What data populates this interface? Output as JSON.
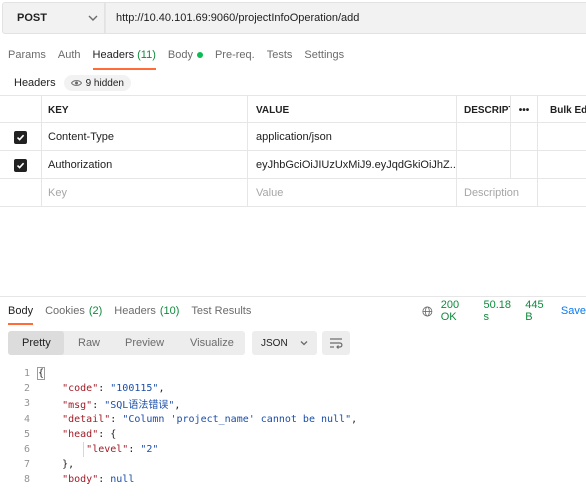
{
  "request": {
    "method": "POST",
    "url": "http://10.40.101.69:9060/projectInfoOperation/add"
  },
  "request_tabs": [
    {
      "label": "Params",
      "count": ""
    },
    {
      "label": "Auth",
      "count": ""
    },
    {
      "label": "Headers",
      "count": "(11)"
    },
    {
      "label": "Body",
      "count": ""
    },
    {
      "label": "Pre-req.",
      "count": ""
    },
    {
      "label": "Tests",
      "count": ""
    },
    {
      "label": "Settings",
      "count": ""
    }
  ],
  "headers_section": {
    "label": "Headers",
    "hidden_label": "9 hidden"
  },
  "headers_table": {
    "columns": [
      "KEY",
      "VALUE",
      "DESCRIPTION",
      "•••",
      "Bulk Edit"
    ],
    "rows": [
      {
        "checked": true,
        "key": "Content-Type",
        "value": "application/json",
        "description": ""
      },
      {
        "checked": true,
        "key": "Authorization",
        "value": "eyJhbGciOiJIUzUxMiJ9.eyJqdGkiOiJhZ...",
        "description": ""
      }
    ],
    "placeholders": {
      "key": "Key",
      "value": "Value",
      "description": "Description"
    }
  },
  "response_tabs": [
    {
      "label": "Body",
      "count": ""
    },
    {
      "label": "Cookies",
      "count": "(2)"
    },
    {
      "label": "Headers",
      "count": "(10)"
    },
    {
      "label": "Test Results",
      "count": ""
    }
  ],
  "response_status": {
    "status": "200 OK",
    "time": "50.18 s",
    "size": "445 B",
    "save": "Save"
  },
  "view_modes": [
    "Pretty",
    "Raw",
    "Preview",
    "Visualize"
  ],
  "format": "JSON",
  "response_body_lines": [
    "1",
    "2",
    "3",
    "4",
    "5",
    "6",
    "7",
    "8"
  ],
  "response_body": {
    "code_key": "\"code\"",
    "code_val": "\"100115\"",
    "msg_key": "\"msg\"",
    "msg_val": "\"SQL语法错误\"",
    "detail_key": "\"detail\"",
    "detail_val": "\"Column 'project_name' cannot be null\"",
    "head_key": "\"head\"",
    "level_key": "\"level\"",
    "level_val": "\"2\"",
    "body_key": "\"body\"",
    "body_val": "null"
  },
  "colors": {
    "accent": "#ff6c37",
    "success": "#0f8a3c",
    "link": "#097bed",
    "json_key": "#a01c26",
    "json_value": "#1a4eaa"
  }
}
